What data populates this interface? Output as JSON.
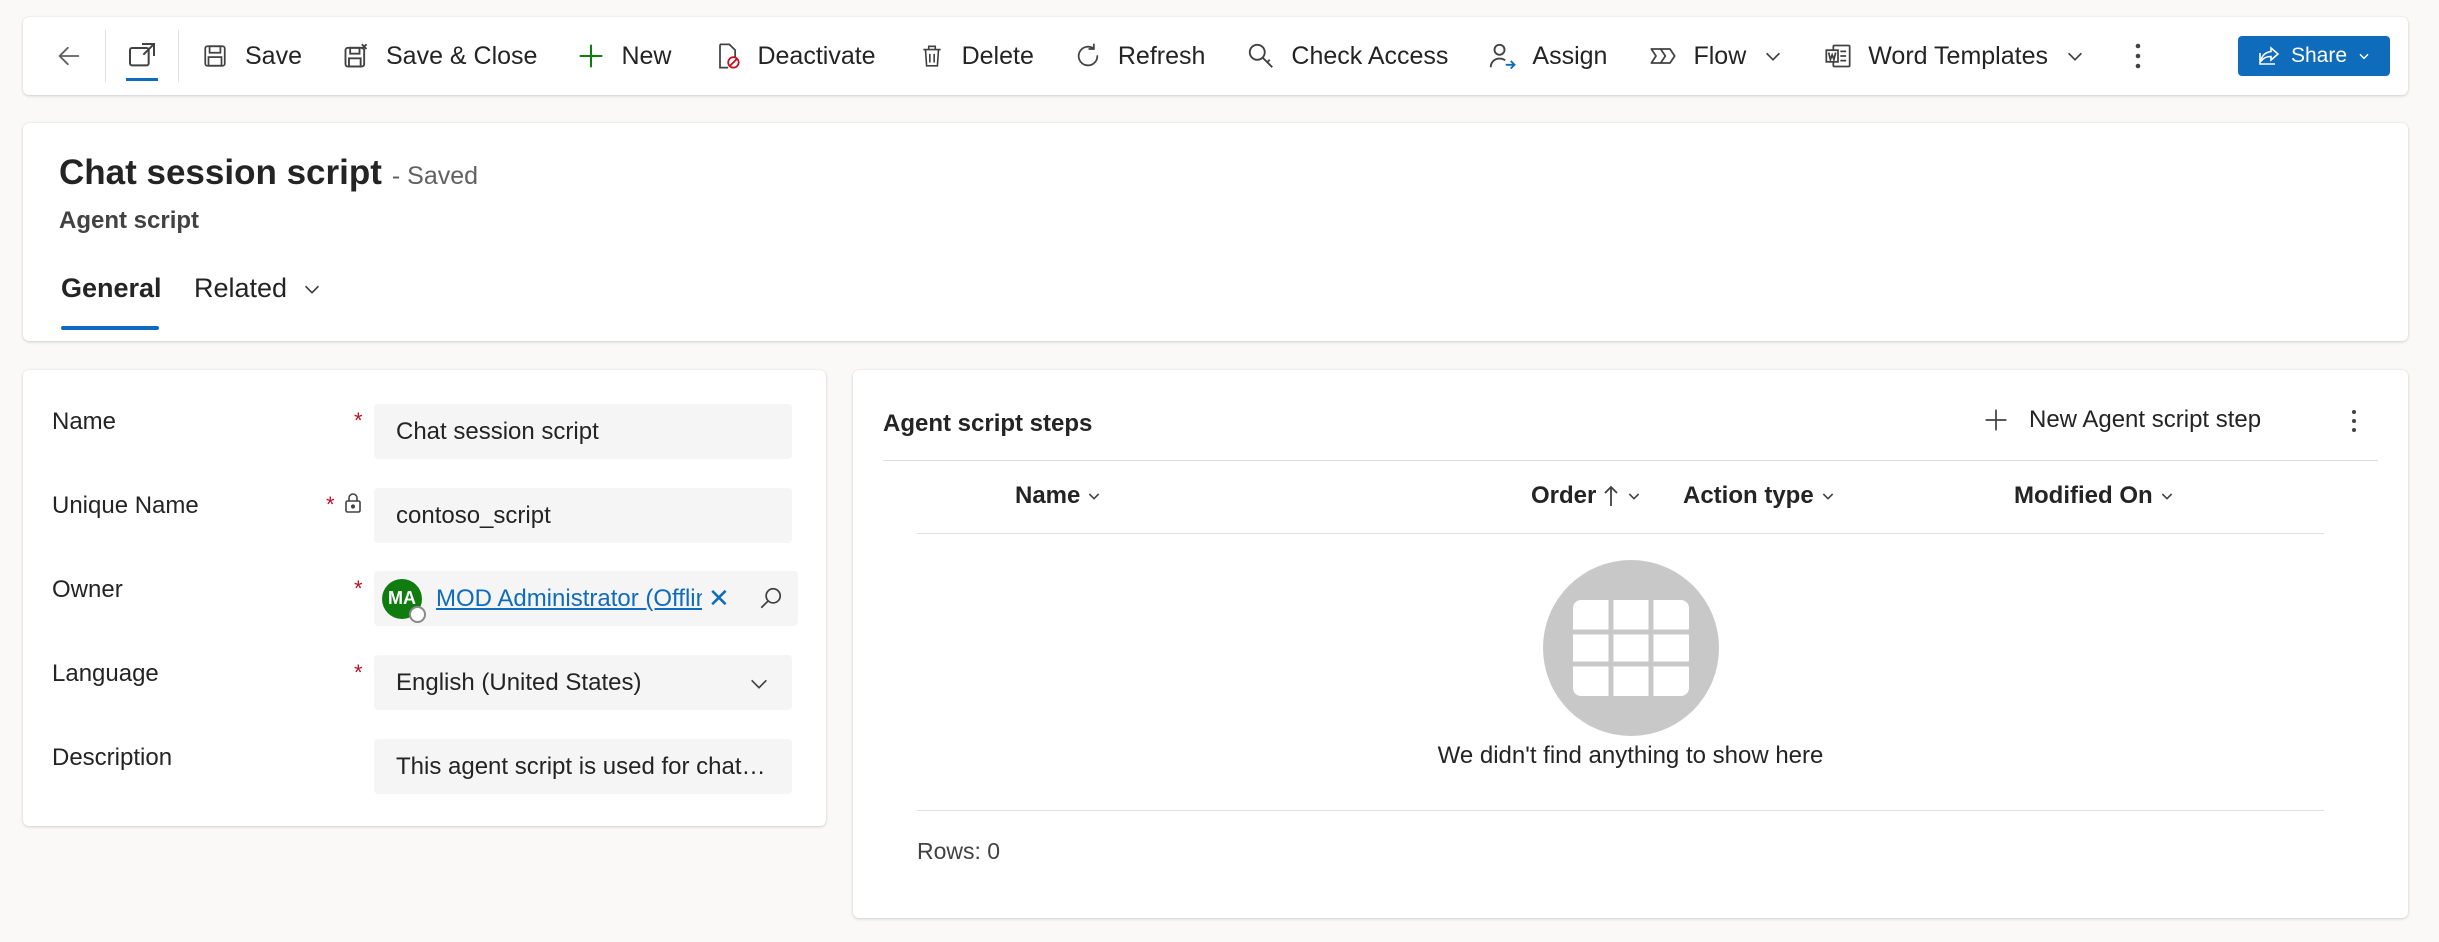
{
  "commandbar": {
    "save": "Save",
    "save_close": "Save & Close",
    "new": "New",
    "deactivate": "Deactivate",
    "delete": "Delete",
    "refresh": "Refresh",
    "check_access": "Check Access",
    "assign": "Assign",
    "flow": "Flow",
    "word_templates": "Word Templates",
    "share": "Share"
  },
  "header": {
    "title": "Chat session script",
    "status": "- Saved",
    "entity": "Agent script",
    "tabs": [
      "General",
      "Related"
    ]
  },
  "form": {
    "name_label": "Name",
    "name_value": "Chat session script",
    "unique_label": "Unique Name",
    "unique_value": "contoso_script",
    "owner_label": "Owner",
    "owner_initials": "MA",
    "owner_value": "MOD Administrator (Offline)",
    "language_label": "Language",
    "language_value": "English (United States)",
    "description_label": "Description",
    "description_value": "This agent script is used for chat sessions",
    "required_mark": "*"
  },
  "grid": {
    "title": "Agent script steps",
    "new_label": "New Agent script step",
    "columns": [
      "Name",
      "Order",
      "Action type",
      "Modified On"
    ],
    "empty_message": "We didn't find anything to show here",
    "rows_label": "Rows: 0"
  },
  "colors": {
    "accent": "#0f6cbd",
    "required": "#c50f1f",
    "avatar": "#107c10"
  }
}
